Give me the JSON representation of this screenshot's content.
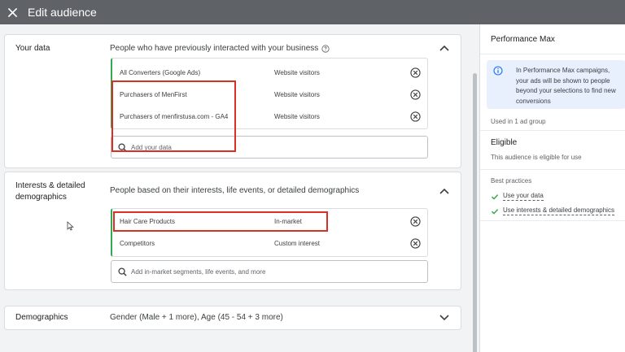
{
  "header": {
    "title": "Edit audience"
  },
  "your_data": {
    "label": "Your data",
    "description": "People who have previously interacted with your business",
    "items": [
      {
        "name": "All Converters (Google Ads)",
        "type": "Website visitors"
      },
      {
        "name": "Purchasers of MenFirst",
        "type": "Website visitors"
      },
      {
        "name": "Purchasers of menfirstusa.com - GA4",
        "type": "Website visitors"
      }
    ],
    "search_placeholder": "Add your data"
  },
  "interests": {
    "label_line1": "Interests & detailed",
    "label_line2": "demographics",
    "description": "People based on their interests, life events, or detailed demographics",
    "items": [
      {
        "name": "Hair Care Products",
        "type": "In-market"
      },
      {
        "name": "Competitors",
        "type": "Custom interest"
      }
    ],
    "search_placeholder": "Add in-market segments, life events, and more"
  },
  "demographics": {
    "label": "Demographics",
    "summary": "Gender (Male + 1 more), Age (45 - 54 + 3 more)"
  },
  "side_panel": {
    "title": "Performance Max",
    "info_text": "In Performance Max campaigns, your ads will be shown to people beyond your selections to find new conversions",
    "used_in": "Used in 1 ad group",
    "status_title": "Eligible",
    "status_text": "This audience is eligible for use",
    "best_practices_title": "Best practices",
    "best_practices": [
      "Use your data",
      "Use interests & detailed demographics"
    ]
  },
  "colors": {
    "accent_green": "#34a853",
    "highlight_red": "#d93025",
    "info_blue": "#1a73e8",
    "topbar": "#5f6368"
  }
}
